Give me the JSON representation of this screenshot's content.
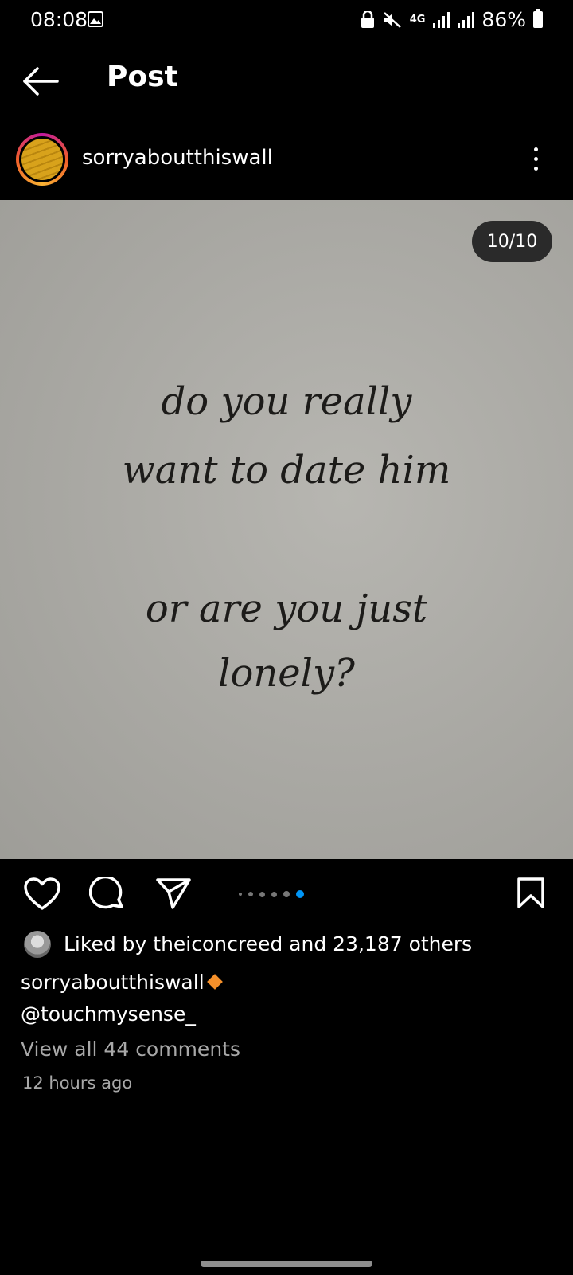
{
  "status_bar": {
    "time": "08:08",
    "network": "4G",
    "battery": "86%"
  },
  "header": {
    "title": "Post",
    "back_icon": "back-arrow-icon"
  },
  "post": {
    "username": "sorryaboutthiswall",
    "image_counter": "10/10",
    "image_text": [
      "do you really",
      "want to date him",
      "or are you just",
      "lonely?"
    ],
    "carousel": {
      "total": 6,
      "active_index": 5
    },
    "likes_text": "Liked by theiconcreed and 23,187 others",
    "caption_user": "sorryaboutthiswall",
    "caption_mention": "@touchmysense_",
    "view_comments": "View all 44 comments",
    "timestamp": "12 hours ago"
  },
  "colors": {
    "accent_dot": "#0095f6",
    "background": "#000000",
    "muted_text": "#a8a8a8"
  }
}
